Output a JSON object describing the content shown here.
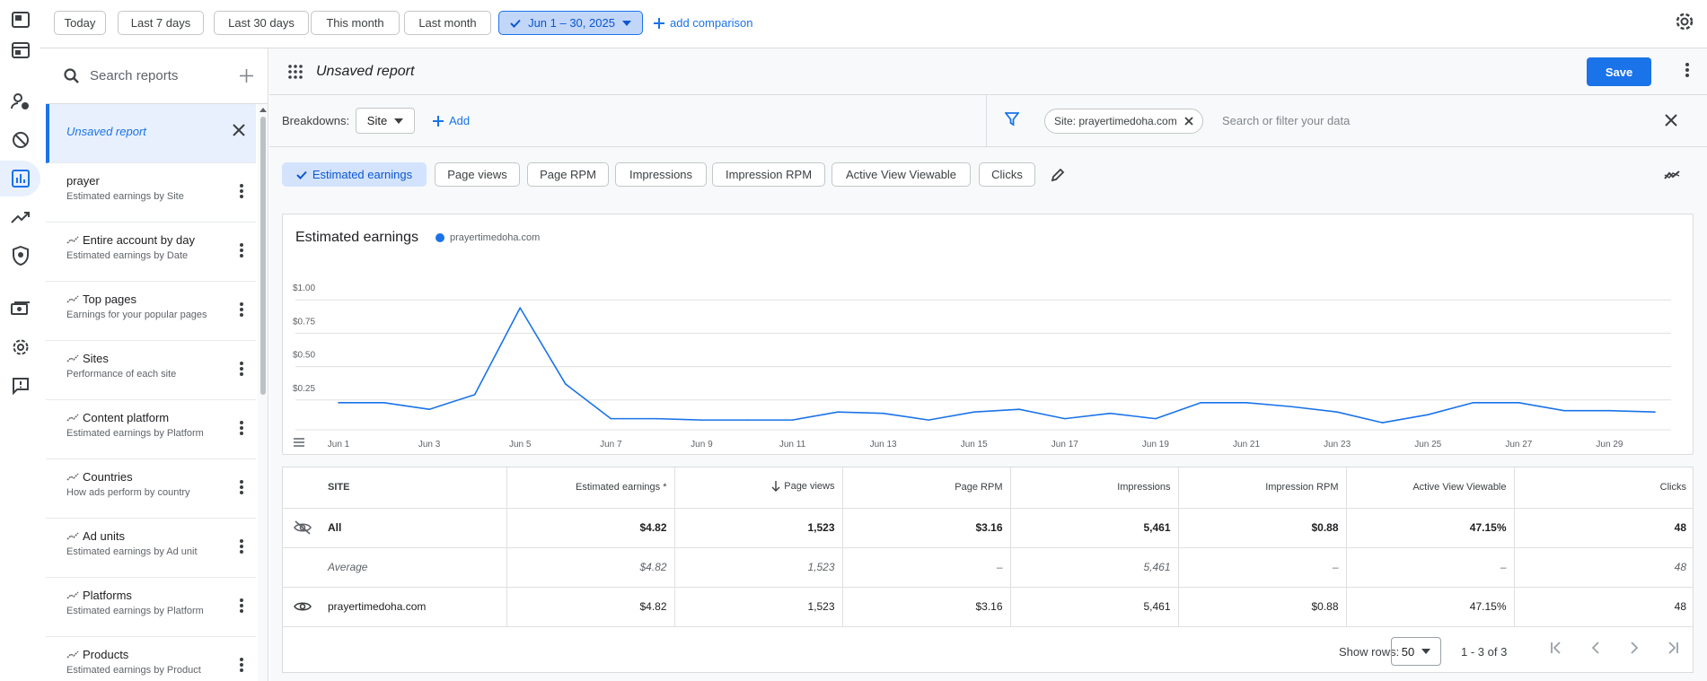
{
  "date_chips": [
    "Today",
    "Last 7 days",
    "Last 30 days",
    "This month",
    "Last month"
  ],
  "date_range": "Jun 1 – 30, 2025",
  "add_comparison": "add comparison",
  "search": {
    "placeholder": "Search reports"
  },
  "reports": [
    {
      "title": "Unsaved report",
      "sub": ""
    },
    {
      "title": "prayer",
      "sub": "Estimated earnings by Site"
    },
    {
      "title": "Entire account by day",
      "sub": "Estimated earnings by Date"
    },
    {
      "title": "Top pages",
      "sub": "Earnings for your popular pages"
    },
    {
      "title": "Sites",
      "sub": "Performance of each site"
    },
    {
      "title": "Content platform",
      "sub": "Estimated earnings by Platform"
    },
    {
      "title": "Countries",
      "sub": "How ads perform by country"
    },
    {
      "title": "Ad units",
      "sub": "Estimated earnings by Ad unit"
    },
    {
      "title": "Platforms",
      "sub": "Estimated earnings by Platform"
    },
    {
      "title": "Products",
      "sub": "Estimated earnings by Product"
    }
  ],
  "report_title": "Unsaved report",
  "save_label": "Save",
  "breakdowns": {
    "label": "Breakdowns:",
    "value": "Site",
    "add": "Add"
  },
  "filter": {
    "chip": "Site: prayertimedoha.com",
    "placeholder": "Search or filter your data"
  },
  "metrics": [
    "Estimated earnings",
    "Page views",
    "Page RPM",
    "Impressions",
    "Impression RPM",
    "Active View Viewable",
    "Clicks"
  ],
  "chart_title": "Estimated earnings",
  "colors": {
    "accent": "#1a73e8",
    "selected_chip": "#d3e3fd"
  },
  "chart_data": {
    "type": "line",
    "title": "Estimated earnings",
    "series": [
      {
        "name": "prayertimedoha.com",
        "values": [
          0.23,
          0.23,
          0.18,
          0.29,
          0.94,
          0.37,
          0.11,
          0.11,
          0.1,
          0.1,
          0.1,
          0.16,
          0.15,
          0.1,
          0.16,
          0.18,
          0.11,
          0.15,
          0.11,
          0.23,
          0.23,
          0.2,
          0.16,
          0.08,
          0.14,
          0.23,
          0.23,
          0.17,
          0.17,
          0.16
        ]
      }
    ],
    "x": [
      "Jun 1",
      "Jun 2",
      "Jun 3",
      "Jun 4",
      "Jun 5",
      "Jun 6",
      "Jun 7",
      "Jun 8",
      "Jun 9",
      "Jun 10",
      "Jun 11",
      "Jun 12",
      "Jun 13",
      "Jun 14",
      "Jun 15",
      "Jun 16",
      "Jun 17",
      "Jun 18",
      "Jun 19",
      "Jun 20",
      "Jun 21",
      "Jun 22",
      "Jun 23",
      "Jun 24",
      "Jun 25",
      "Jun 26",
      "Jun 27",
      "Jun 28",
      "Jun 29",
      "Jun 30"
    ],
    "x_tick_labels": [
      "Jun 1",
      "Jun 3",
      "Jun 5",
      "Jun 7",
      "Jun 9",
      "Jun 11",
      "Jun 13",
      "Jun 15",
      "Jun 17",
      "Jun 19",
      "Jun 21",
      "Jun 23",
      "Jun 25",
      "Jun 27",
      "Jun 29"
    ],
    "y_ticks": [
      "$0.25",
      "$0.50",
      "$0.75",
      "$1.00"
    ],
    "ylim": [
      0,
      1.25
    ],
    "grid": true,
    "legend_position": "top-left"
  },
  "table": {
    "headers": [
      "SITE",
      "Estimated earnings *",
      "Page views",
      "Page RPM",
      "Impressions",
      "Impression RPM",
      "Active View Viewable",
      "Clicks"
    ],
    "rows": [
      {
        "site": "All",
        "cells": [
          "$4.82",
          "1,523",
          "$3.16",
          "5,461",
          "$0.88",
          "47.15%",
          "48"
        ]
      },
      {
        "site": "Average",
        "cells": [
          "$4.82",
          "1,523",
          "–",
          "5,461",
          "–",
          "–",
          "48"
        ]
      },
      {
        "site": "prayertimedoha.com",
        "cells": [
          "$4.82",
          "1,523",
          "$3.16",
          "5,461",
          "$0.88",
          "47.15%",
          "48"
        ]
      }
    ]
  },
  "pager": {
    "show_rows": "Show rows:",
    "rows_value": "50",
    "range": "1 - 3 of 3"
  }
}
